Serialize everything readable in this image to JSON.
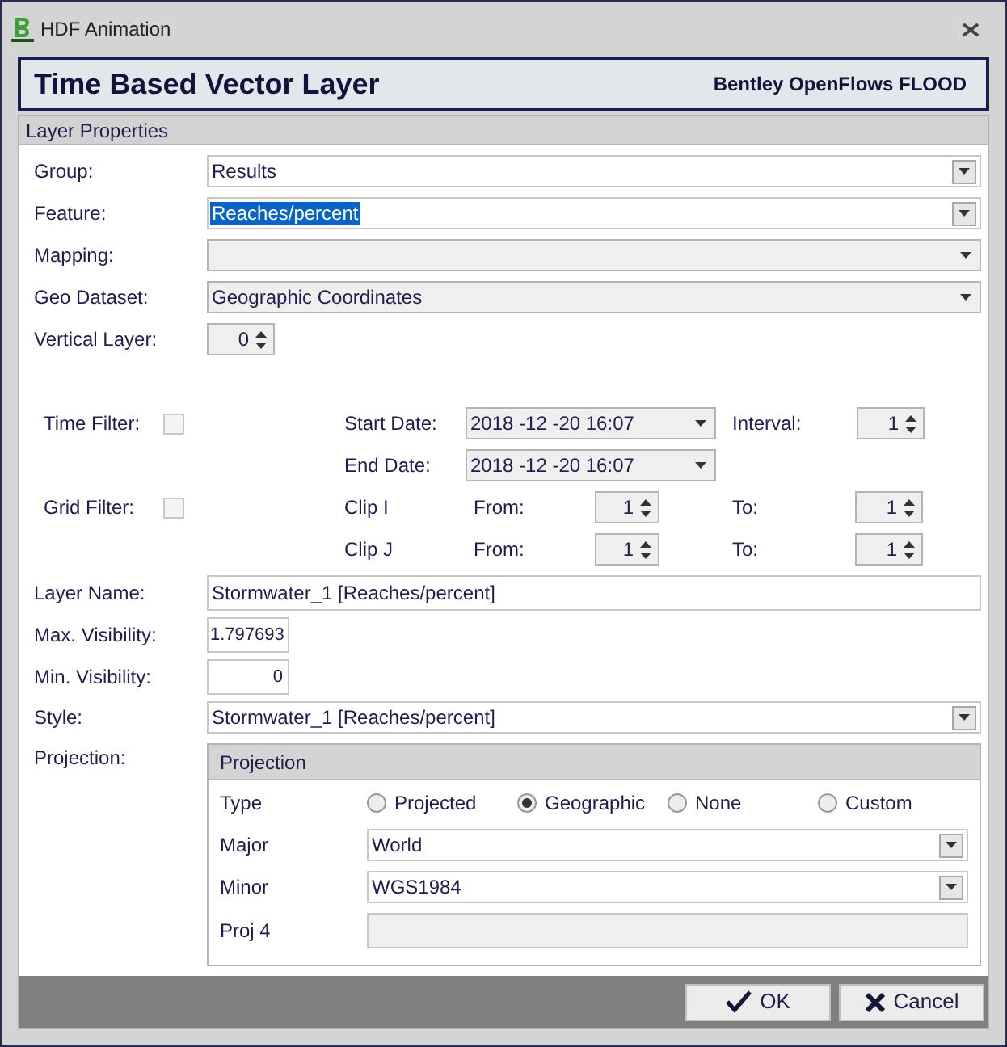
{
  "window": {
    "title": "HDF Animation"
  },
  "header": {
    "title": "Time Based Vector Layer",
    "product": "Bentley OpenFlows FLOOD"
  },
  "section_title": "Layer Properties",
  "top_fields": [
    {
      "label": "Group:",
      "kind": "dropdown",
      "value": "Results",
      "highlighted": false
    },
    {
      "label": "Feature:",
      "kind": "dropdown",
      "value": "Reaches/percent",
      "highlighted": true
    },
    {
      "label": "Mapping:",
      "kind": "combo"
    },
    {
      "label": "Geo Dataset:",
      "kind": "combo",
      "value": "Geographic Coordinates"
    },
    {
      "label": "Vertical Layer:",
      "kind": "spinner",
      "value": "0"
    }
  ],
  "filters": {
    "time_filter": {
      "label": "Time Filter:",
      "checked": false
    },
    "start_date": {
      "label": "Start Date:",
      "value": "2018 -12 -20 16:07"
    },
    "interval": {
      "label": "Interval:",
      "value": "1"
    },
    "end_date": {
      "label": "End Date:",
      "value": "2018 -12 -20 16:07"
    },
    "grid_filter": {
      "label": "Grid Filter:",
      "checked": false
    },
    "clips": [
      {
        "label": "Clip I",
        "from_label": "From:",
        "from": "1",
        "to_label": "To:",
        "to": "1"
      },
      {
        "label": "Clip J",
        "from_label": "From:",
        "from": "1",
        "to_label": "To:",
        "to": "1"
      }
    ]
  },
  "lower_fields": [
    {
      "label": "Layer Name:",
      "kind": "text",
      "value": "Stormwater_1 [Reaches/percent]"
    },
    {
      "label": "Max. Visibility:",
      "kind": "short",
      "value": "1.797693"
    },
    {
      "label": "Min. Visibility:",
      "kind": "number",
      "value": "0"
    },
    {
      "label": "Style:",
      "kind": "dropdown",
      "value": "Stormwater_1 [Reaches/percent]",
      "highlighted": false
    }
  ],
  "projection": {
    "label": "Projection:",
    "title": "Projection",
    "type_label": "Type",
    "options": [
      {
        "label": "Projected",
        "selected": false
      },
      {
        "label": "Geographic",
        "selected": true
      },
      {
        "label": "None",
        "selected": false
      },
      {
        "label": "Custom",
        "selected": false
      }
    ],
    "fields": [
      {
        "label": "Major",
        "kind": "dropdown",
        "value": "World",
        "highlighted": false
      },
      {
        "label": "Minor",
        "kind": "dropdown",
        "value": "WGS1984",
        "highlighted": false
      },
      {
        "label": "Proj 4",
        "kind": "readonly"
      }
    ]
  },
  "buttons": [
    {
      "label": "OK",
      "kind": "ok"
    },
    {
      "label": "Cancel",
      "kind": "cancel"
    }
  ]
}
